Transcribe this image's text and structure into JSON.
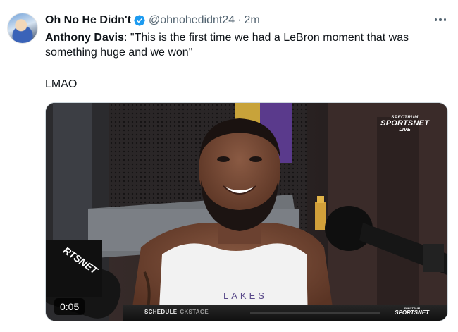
{
  "tweet": {
    "display_name": "Oh No He Didn't",
    "handle": "@ohnohedidnt24",
    "separator": "·",
    "time": "2m",
    "speaker": "Anthony Davis",
    "quote": ": \"This is the first time we had a LeBron moment that was something huge and we won\"",
    "reaction": "LMAO"
  },
  "media": {
    "broadcaster_small": "SPECTRUM",
    "broadcaster_name": "SPORTSNET",
    "broadcaster_live": "LIVE",
    "timestamp": "0:05",
    "ticker_text": "SCHEDULE",
    "ticker_text2": "CKSTAGE",
    "ticker_logo_small": "SPECTRUM",
    "ticker_logo_name": "SPORTSNET",
    "mic_flag_text": "RTSNET",
    "shirt_text": "LAKES"
  },
  "colors": {
    "verified_blue": "#1d9bf0",
    "secondary_text": "#536471",
    "primary_text": "#0f1419"
  },
  "icons": {
    "verified": "verified-badge-icon",
    "more": "more-options-icon"
  }
}
